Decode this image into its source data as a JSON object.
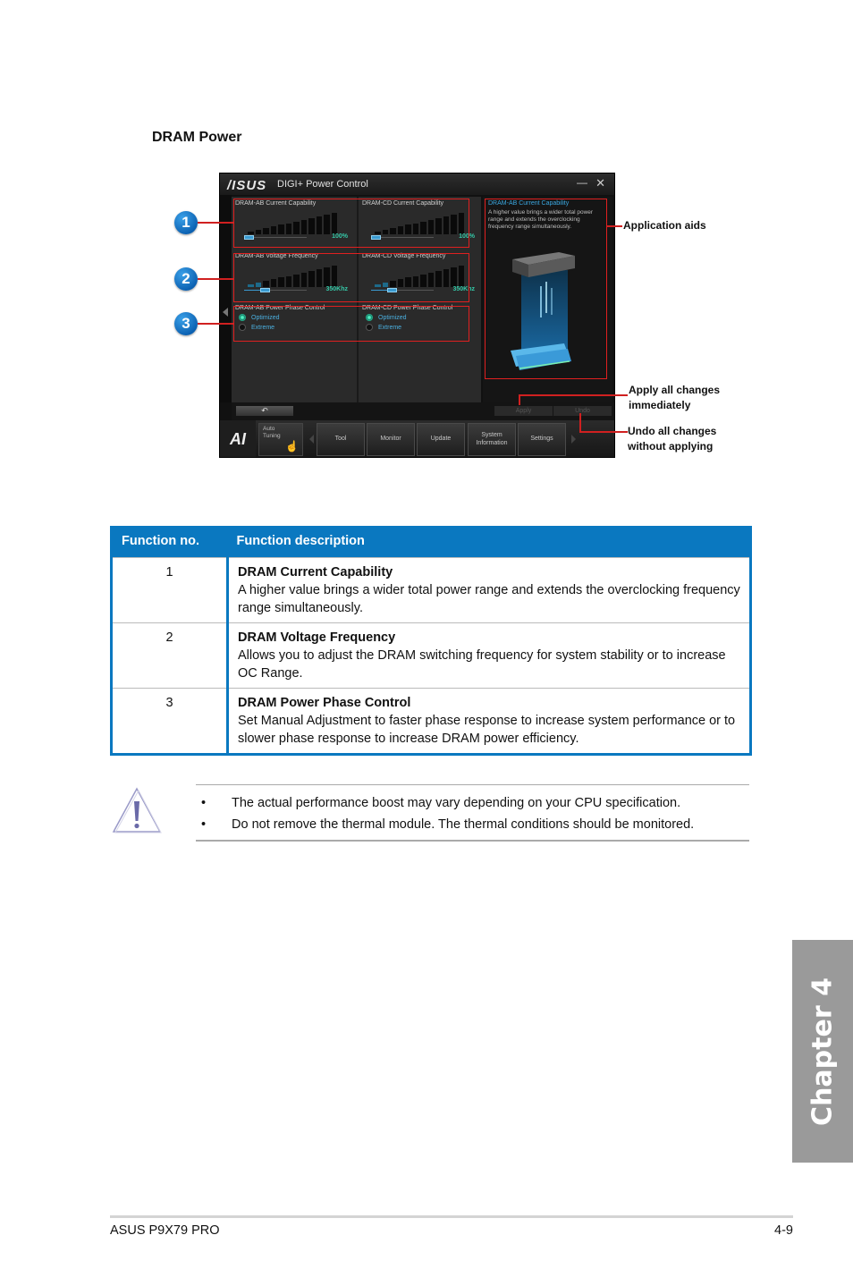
{
  "section_title": "DRAM Power",
  "app": {
    "logo": "/ISUS",
    "title": "DIGI+ Power Control",
    "minimize_icon": "minimize-icon",
    "close_icon": "close-icon",
    "panels": {
      "ab_current": {
        "label": "DRAM-AB Current Capability",
        "value": "100%",
        "level": 0.0
      },
      "cd_current": {
        "label": "DRAM-CD Current Capability",
        "value": "100%",
        "level": 0.0
      },
      "ab_voltage": {
        "label": "DRAM-AB Voltage Frequency",
        "value": "350Khz",
        "level": 0.2
      },
      "cd_voltage": {
        "label": "DRAM-CD Voltage Frequency",
        "value": "350Khz",
        "level": 0.2
      },
      "ab_phase": {
        "label": "DRAM-AB Power Phase Control",
        "options": [
          "Optimized",
          "Extreme"
        ],
        "selected": "Optimized"
      },
      "cd_phase": {
        "label": "DRAM-CD Power Phase Control",
        "options": [
          "Optimized",
          "Extreme"
        ],
        "selected": "Optimized"
      }
    },
    "aid": {
      "title": "DRAM-AB Current Capability",
      "text": "A higher value brings a wider total power range and extends the overclocking frequency range simultaneously."
    },
    "back_icon": "↶",
    "apply_label": "Apply",
    "undo_label": "Undo",
    "nav": {
      "logo": "AI",
      "auto_tuning": "Auto Tuning",
      "items": [
        "Tool",
        "Monitor",
        "Update",
        "System Information",
        "Settings"
      ]
    }
  },
  "callouts": {
    "badges": [
      "1",
      "2",
      "3"
    ],
    "application_aids": "Application aids",
    "apply": "Apply all changes immediately",
    "undo": "Undo all changes without applying"
  },
  "table": {
    "headers": [
      "Function no.",
      "Function description"
    ],
    "rows": [
      {
        "no": "1",
        "title": "DRAM Current Capability",
        "desc": "A higher value brings a wider total power range and extends the overclocking frequency range simultaneously."
      },
      {
        "no": "2",
        "title": "DRAM Voltage Frequency",
        "desc": "Allows you to adjust the DRAM switching frequency for system stability or to increase OC Range."
      },
      {
        "no": "3",
        "title": "DRAM Power Phase Control",
        "desc": "Set Manual Adjustment to faster phase response to increase system performance or to slower phase response to increase DRAM power efficiency."
      }
    ]
  },
  "notes": {
    "bullet": "•",
    "items": [
      "The actual performance boost may vary depending on your CPU specification.",
      "Do not remove the thermal module. The thermal conditions should be monitored."
    ]
  },
  "chapter": "Chapter 4",
  "footer": {
    "product": "ASUS P9X79 PRO",
    "page": "4-9"
  },
  "colors": {
    "accent_blue": "#0a78c0",
    "callout_red": "#d02020",
    "chapter_gray": "#9a9a9a",
    "value_green": "#35c9a8"
  }
}
